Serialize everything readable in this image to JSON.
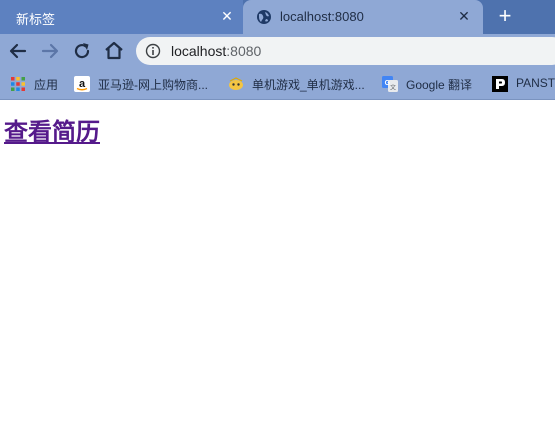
{
  "tabs": [
    {
      "title": "新标签",
      "active": false
    },
    {
      "title": "localhost:8080",
      "active": true
    }
  ],
  "tab_close_glyph": "✕",
  "new_tab_glyph": "+",
  "toolbar": {
    "url_host": "localhost",
    "url_port": ":8080"
  },
  "bookmarks": [
    {
      "label": "应用",
      "icon": "apps-grid-icon"
    },
    {
      "label": "亚马逊-网上购物商...",
      "icon": "amazon-icon"
    },
    {
      "label": "单机游戏_单机游戏...",
      "icon": "game-site-icon"
    },
    {
      "label": "Google 翻译",
      "icon": "google-translate-icon"
    },
    {
      "label": "PANST",
      "icon": "panst-icon"
    }
  ],
  "page": {
    "link_text": "查看简历"
  },
  "colors": {
    "tabstrip": "#4e72ae",
    "toolbar": "#8fa8d5",
    "visited_link": "#551a8b"
  }
}
